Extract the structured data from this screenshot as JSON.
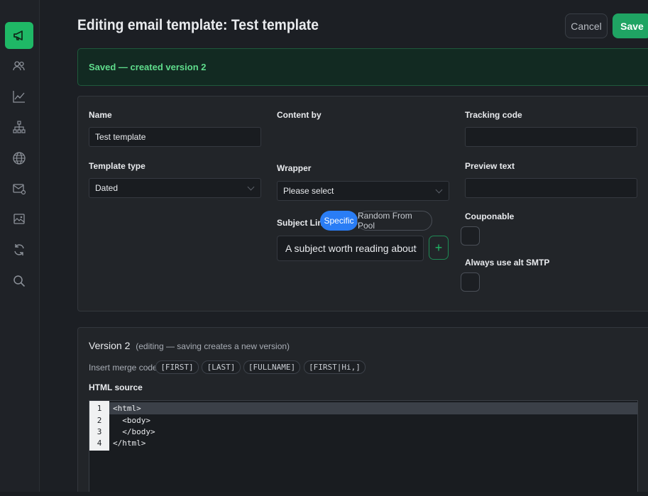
{
  "page": {
    "title": "Editing email template: Test template",
    "cancel_label": "Cancel",
    "save_label": "Save"
  },
  "alert": {
    "text": "Saved — created version 2"
  },
  "sidebar": {
    "active_color": "#1fb866",
    "items": [
      {
        "icon": "megaphone-icon",
        "active": true
      },
      {
        "icon": "users-icon",
        "active": false
      },
      {
        "icon": "chart-line-icon",
        "active": false
      },
      {
        "icon": "sitemap-icon",
        "active": false
      },
      {
        "icon": "globe-icon",
        "active": false
      },
      {
        "icon": "email-at-icon",
        "active": false
      },
      {
        "icon": "images-icon",
        "active": false
      },
      {
        "icon": "refresh-icon",
        "active": false
      },
      {
        "icon": "search-icon",
        "active": false
      }
    ]
  },
  "form": {
    "name_label": "Name",
    "name_value": "Test template",
    "template_type_label": "Template type",
    "template_type_value": "Dated",
    "content_by_label": "Content by",
    "wrapper_label": "Wrapper",
    "wrapper_value": "Please select",
    "subject_line_label": "Subject Line",
    "subject_mode_specific": "Specific",
    "subject_mode_random": "Random From Pool",
    "subject_value": "A subject worth reading about",
    "add_symbol": "+",
    "tracking_code_label": "Tracking code",
    "tracking_code_value": "",
    "preview_text_label": "Preview text",
    "preview_text_value": "",
    "couponable_label": "Couponable",
    "couponable_checked": false,
    "alt_smtp_label": "Always use alt SMTP",
    "alt_smtp_checked": false
  },
  "version": {
    "title": "Version 2",
    "note": "(editing — saving creates a new version)",
    "merge_label": "Insert merge code:",
    "merge_codes": [
      "[FIRST]",
      "[LAST]",
      "[FULLNAME]",
      "[FIRST|Hi,]"
    ],
    "source_label": "HTML source",
    "line_numbers": [
      "1",
      "2",
      "3",
      "4"
    ],
    "code_lines": [
      "<html>",
      "  <body>",
      "  </body>",
      "</html>"
    ]
  },
  "colors": {
    "accent_green": "#1fa463",
    "accent_blue": "#2a7df5",
    "alert_text": "#5fdc8c"
  }
}
